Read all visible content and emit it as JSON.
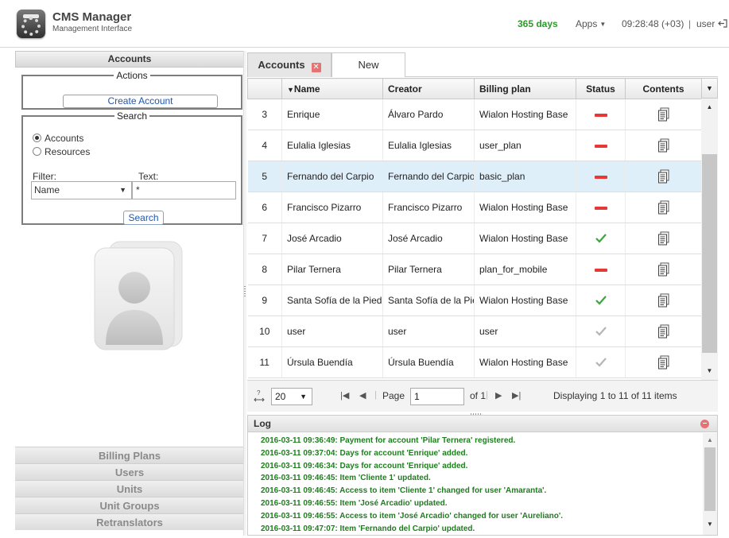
{
  "header": {
    "title": "CMS Manager",
    "subtitle": "Management Interface",
    "days": "365 days",
    "apps_label": "Apps",
    "time": "09:28:48 (+03)",
    "separator": "|",
    "user": "user",
    "days_color": "#2c9a2c"
  },
  "sidebar": {
    "accounts_header": "Accounts",
    "actions_legend": "Actions",
    "create_account": "Create Account",
    "search_legend": "Search",
    "radio_accounts": "Accounts",
    "radio_resources": "Resources",
    "selected_radio": "Accounts",
    "filter_label": "Filter:",
    "text_label": "Text:",
    "filter_value": "Name",
    "text_value": "*",
    "search_button": "Search",
    "nav": [
      "Billing Plans",
      "Users",
      "Units",
      "Unit Groups",
      "Retranslators"
    ]
  },
  "tabs": [
    {
      "label": "Accounts",
      "active": true
    },
    {
      "label": "New",
      "active": false
    }
  ],
  "grid": {
    "columns": [
      "",
      "Name",
      "Creator",
      "Billing plan",
      "Status",
      "Contents"
    ],
    "sort_indicator": "▼",
    "rows": [
      {
        "num": "3",
        "name": "Enrique",
        "creator": "Álvaro Pardo",
        "plan": "Wialon Hosting Base",
        "status": "blocked"
      },
      {
        "num": "4",
        "name": "Eulalia Iglesias",
        "creator": "Eulalia Iglesias",
        "plan": "user_plan",
        "status": "blocked"
      },
      {
        "num": "5",
        "name": "Fernando del Carpio",
        "creator": "Fernando del Carpio",
        "plan": "basic_plan",
        "status": "blocked",
        "selected": true
      },
      {
        "num": "6",
        "name": "Francisco Pizarro",
        "creator": "Francisco Pizarro",
        "plan": "Wialon Hosting Base",
        "status": "blocked"
      },
      {
        "num": "7",
        "name": "José Arcadio",
        "creator": "José Arcadio",
        "plan": "Wialon Hosting Base",
        "status": "active"
      },
      {
        "num": "8",
        "name": "Pilar Ternera",
        "creator": "Pilar Ternera",
        "plan": "plan_for_mobile",
        "status": "blocked"
      },
      {
        "num": "9",
        "name": "Santa Sofía de la Pied",
        "creator": "Santa Sofía de la Pie",
        "plan": "Wialon Hosting Base",
        "status": "active"
      },
      {
        "num": "10",
        "name": "user",
        "creator": "user",
        "plan": "user",
        "status": "inactive"
      },
      {
        "num": "11",
        "name": "Úrsula Buendía",
        "creator": "Úrsula Buendía",
        "plan": "Wialon Hosting Base",
        "status": "inactive"
      }
    ],
    "status_colors": {
      "blocked": "#e53935",
      "active": "#3aa53a",
      "inactive": "#b5b5b5"
    }
  },
  "pager": {
    "page_size": "20",
    "page_label": "Page",
    "page_value": "1",
    "of_label": "of 1",
    "displaying": "Displaying 1 to 11 of 11 items"
  },
  "log": {
    "title": "Log",
    "lines": [
      "2016-03-11 09:36:49: Payment for account 'Pilar Ternera' registered.",
      "2016-03-11 09:37:04: Days for account 'Enrique' added.",
      "2016-03-11 09:46:34: Days for account 'Enrique' added.",
      "2016-03-11 09:46:45: Item 'Cliente 1' updated.",
      "2016-03-11 09:46:45: Access to item 'Cliente 1' changed for user 'Amaranta'.",
      "2016-03-11 09:46:55: Item 'José Arcadio' updated.",
      "2016-03-11 09:46:55: Access to item 'José Arcadio' changed for user 'Aureliano'.",
      "2016-03-11 09:47:07: Item 'Fernando del Carpio' updated."
    ],
    "line_color": "#1e7e1e"
  }
}
